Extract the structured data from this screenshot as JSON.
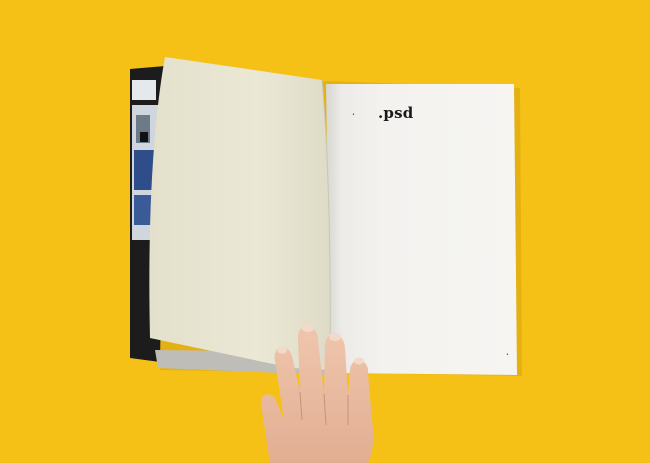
{
  "scene": {
    "background_color": "#f5c117",
    "book_page_title": ".psd",
    "page_marker_top": "•",
    "page_marker_bottom": "•"
  }
}
